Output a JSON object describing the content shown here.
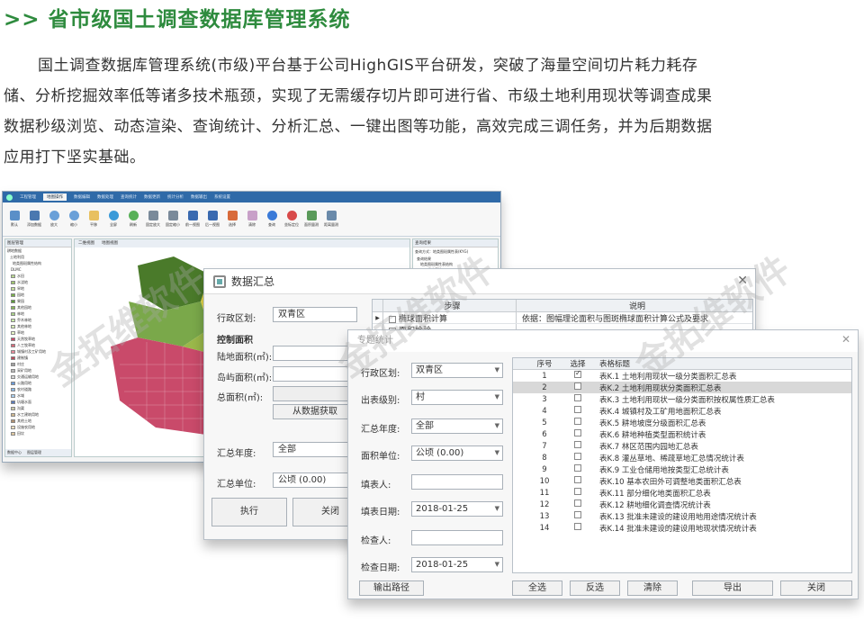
{
  "header": {
    "title": ">> 省市级国土调查数据库管理系统",
    "intro_lines": [
      "国土调查数据库管理系统(市级)平台基于公司HighGIS平台研发，突破了海量空间切片耗力耗存",
      "储、分析挖掘效率低等诸多技术瓶颈，实现了无需缓存切片即可进行省、市级土地利用现状等调查成果",
      "数据秒级浏览、动态渲染、查询统计、分析汇总、一键出图等功能，高效完成三调任务，并为后期数据",
      "应用打下坚实基础。"
    ]
  },
  "watermark": "金拓维软件",
  "app": {
    "tabs": [
      "工程管理",
      "地图操作",
      "数据编辑",
      "数据处理",
      "查询统计",
      "数据更新",
      "统计分析",
      "数据输出",
      "系统设置"
    ],
    "ribbon": [
      "默认",
      "添加数据",
      "放大",
      "缩小",
      "平移",
      "全屏",
      "刷新",
      "固定放大",
      "固定缩小",
      "前一视图",
      "后一视图",
      "选择",
      "清除",
      "查询",
      "坐标定位",
      "面积量测",
      "距离量测"
    ],
    "left_panel_title": "图层管理",
    "layers": [
      "耕地数据",
      "土地利用",
      "地类图斑属性结构",
      "DLMC",
      "水田",
      "水浇地",
      "旱地",
      "园地",
      "果园",
      "其他园地",
      "林地",
      "乔木林地",
      "其他林地",
      "草地",
      "天然牧草地",
      "人工牧草地",
      "城镇村及工矿用地",
      "建制镇",
      "村庄",
      "采矿用地",
      "交通运输用地",
      "公路用地",
      "农村道路",
      "水域",
      "坑塘水面",
      "沟渠",
      "水工建筑用地",
      "其他土地",
      "设施农用地",
      "田坎"
    ],
    "left_bottom_tabs": [
      "数据中心",
      "图层管理"
    ],
    "map_tabs": [
      "二维视图",
      "地图视图"
    ],
    "right_panel_title": "查询结果",
    "right_panel_tab": "查询方式：地类图斑属性表(KYG)",
    "right_panel_items": [
      "查询结果",
      "地类图斑属性表结构",
      "一般农用地"
    ]
  },
  "dialog1": {
    "title": "数据汇总",
    "region_label": "行政区划:",
    "region_value": "双青区",
    "control_area_label": "控制面积",
    "land_area_label": "陆地面积(㎡):",
    "island_area_label": "岛屿面积(㎡):",
    "total_area_label": "总面积(㎡):",
    "fetch_button": "从数据获取",
    "year_label": "汇总年度:",
    "year_value": "全部",
    "unit_label": "汇总单位:",
    "unit_value": "公顷 (0.00)",
    "execute_button": "执行",
    "close_button": "关闭",
    "grid_headers": [
      "步骤",
      "说明"
    ],
    "grid_rows": [
      {
        "step": "椭球面积计算",
        "desc": "依据：图幅理论面积与图斑椭球面积计算公式及要求"
      },
      {
        "step": "面积检验",
        "desc": ""
      }
    ]
  },
  "dialog2": {
    "title": "专题统计",
    "fields": [
      {
        "label": "行政区划:",
        "value": "双青区"
      },
      {
        "label": "出表级别:",
        "value": "村"
      },
      {
        "label": "汇总年度:",
        "value": "全部"
      },
      {
        "label": "面积单位:",
        "value": "公顷 (0.00)"
      },
      {
        "label": "填表人:",
        "value": ""
      },
      {
        "label": "填表日期:",
        "value": "2018-01-25"
      },
      {
        "label": "检查人:",
        "value": ""
      },
      {
        "label": "检查日期:",
        "value": "2018-01-25"
      }
    ],
    "table_headers": [
      "序号",
      "选择",
      "表格标题"
    ],
    "rows": [
      {
        "no": "1",
        "title": "表K.1 土地利用现状一级分类面积汇总表"
      },
      {
        "no": "2",
        "title": "表K.2 土地利用现状分类面积汇总表"
      },
      {
        "no": "3",
        "title": "表K.3 土地利用现状一级分类面积按权属性质汇总表"
      },
      {
        "no": "4",
        "title": "表K.4 城镇村及工矿用地面积汇总表"
      },
      {
        "no": "5",
        "title": "表K.5 耕地坡度分级面积汇总表"
      },
      {
        "no": "6",
        "title": "表K.6 耕地种植类型面积统计表"
      },
      {
        "no": "7",
        "title": "表K.7 林区范围内园地汇总表"
      },
      {
        "no": "8",
        "title": "表K.8 灌丛草地、稀疏草地汇总情况统计表"
      },
      {
        "no": "9",
        "title": "表K.9 工业仓储用地按类型汇总统计表"
      },
      {
        "no": "10",
        "title": "表K.10 基本农田外可调整地类面积汇总表"
      },
      {
        "no": "11",
        "title": "表K.11 部分细化地类面积汇总表"
      },
      {
        "no": "12",
        "title": "表K.12 耕地细化调查情况统计表"
      },
      {
        "no": "13",
        "title": "表K.13 批准未建设的建设用地用途情况统计表"
      },
      {
        "no": "14",
        "title": "表K.14 批准未建设的建设用地现状情况统计表"
      }
    ],
    "selected_row": 2,
    "checked_row": 1,
    "buttons": {
      "output_path": "输出路径",
      "select_all": "全选",
      "invert": "反选",
      "clear": "清除",
      "export": "导出",
      "close": "关闭"
    }
  },
  "colors": {
    "title_green": "#2e8b3e",
    "app_blue": "#2f6aa8",
    "map_pink": "#c94a6a",
    "map_green": "#4a7a2a",
    "map_yellow": "#e6d84a"
  }
}
